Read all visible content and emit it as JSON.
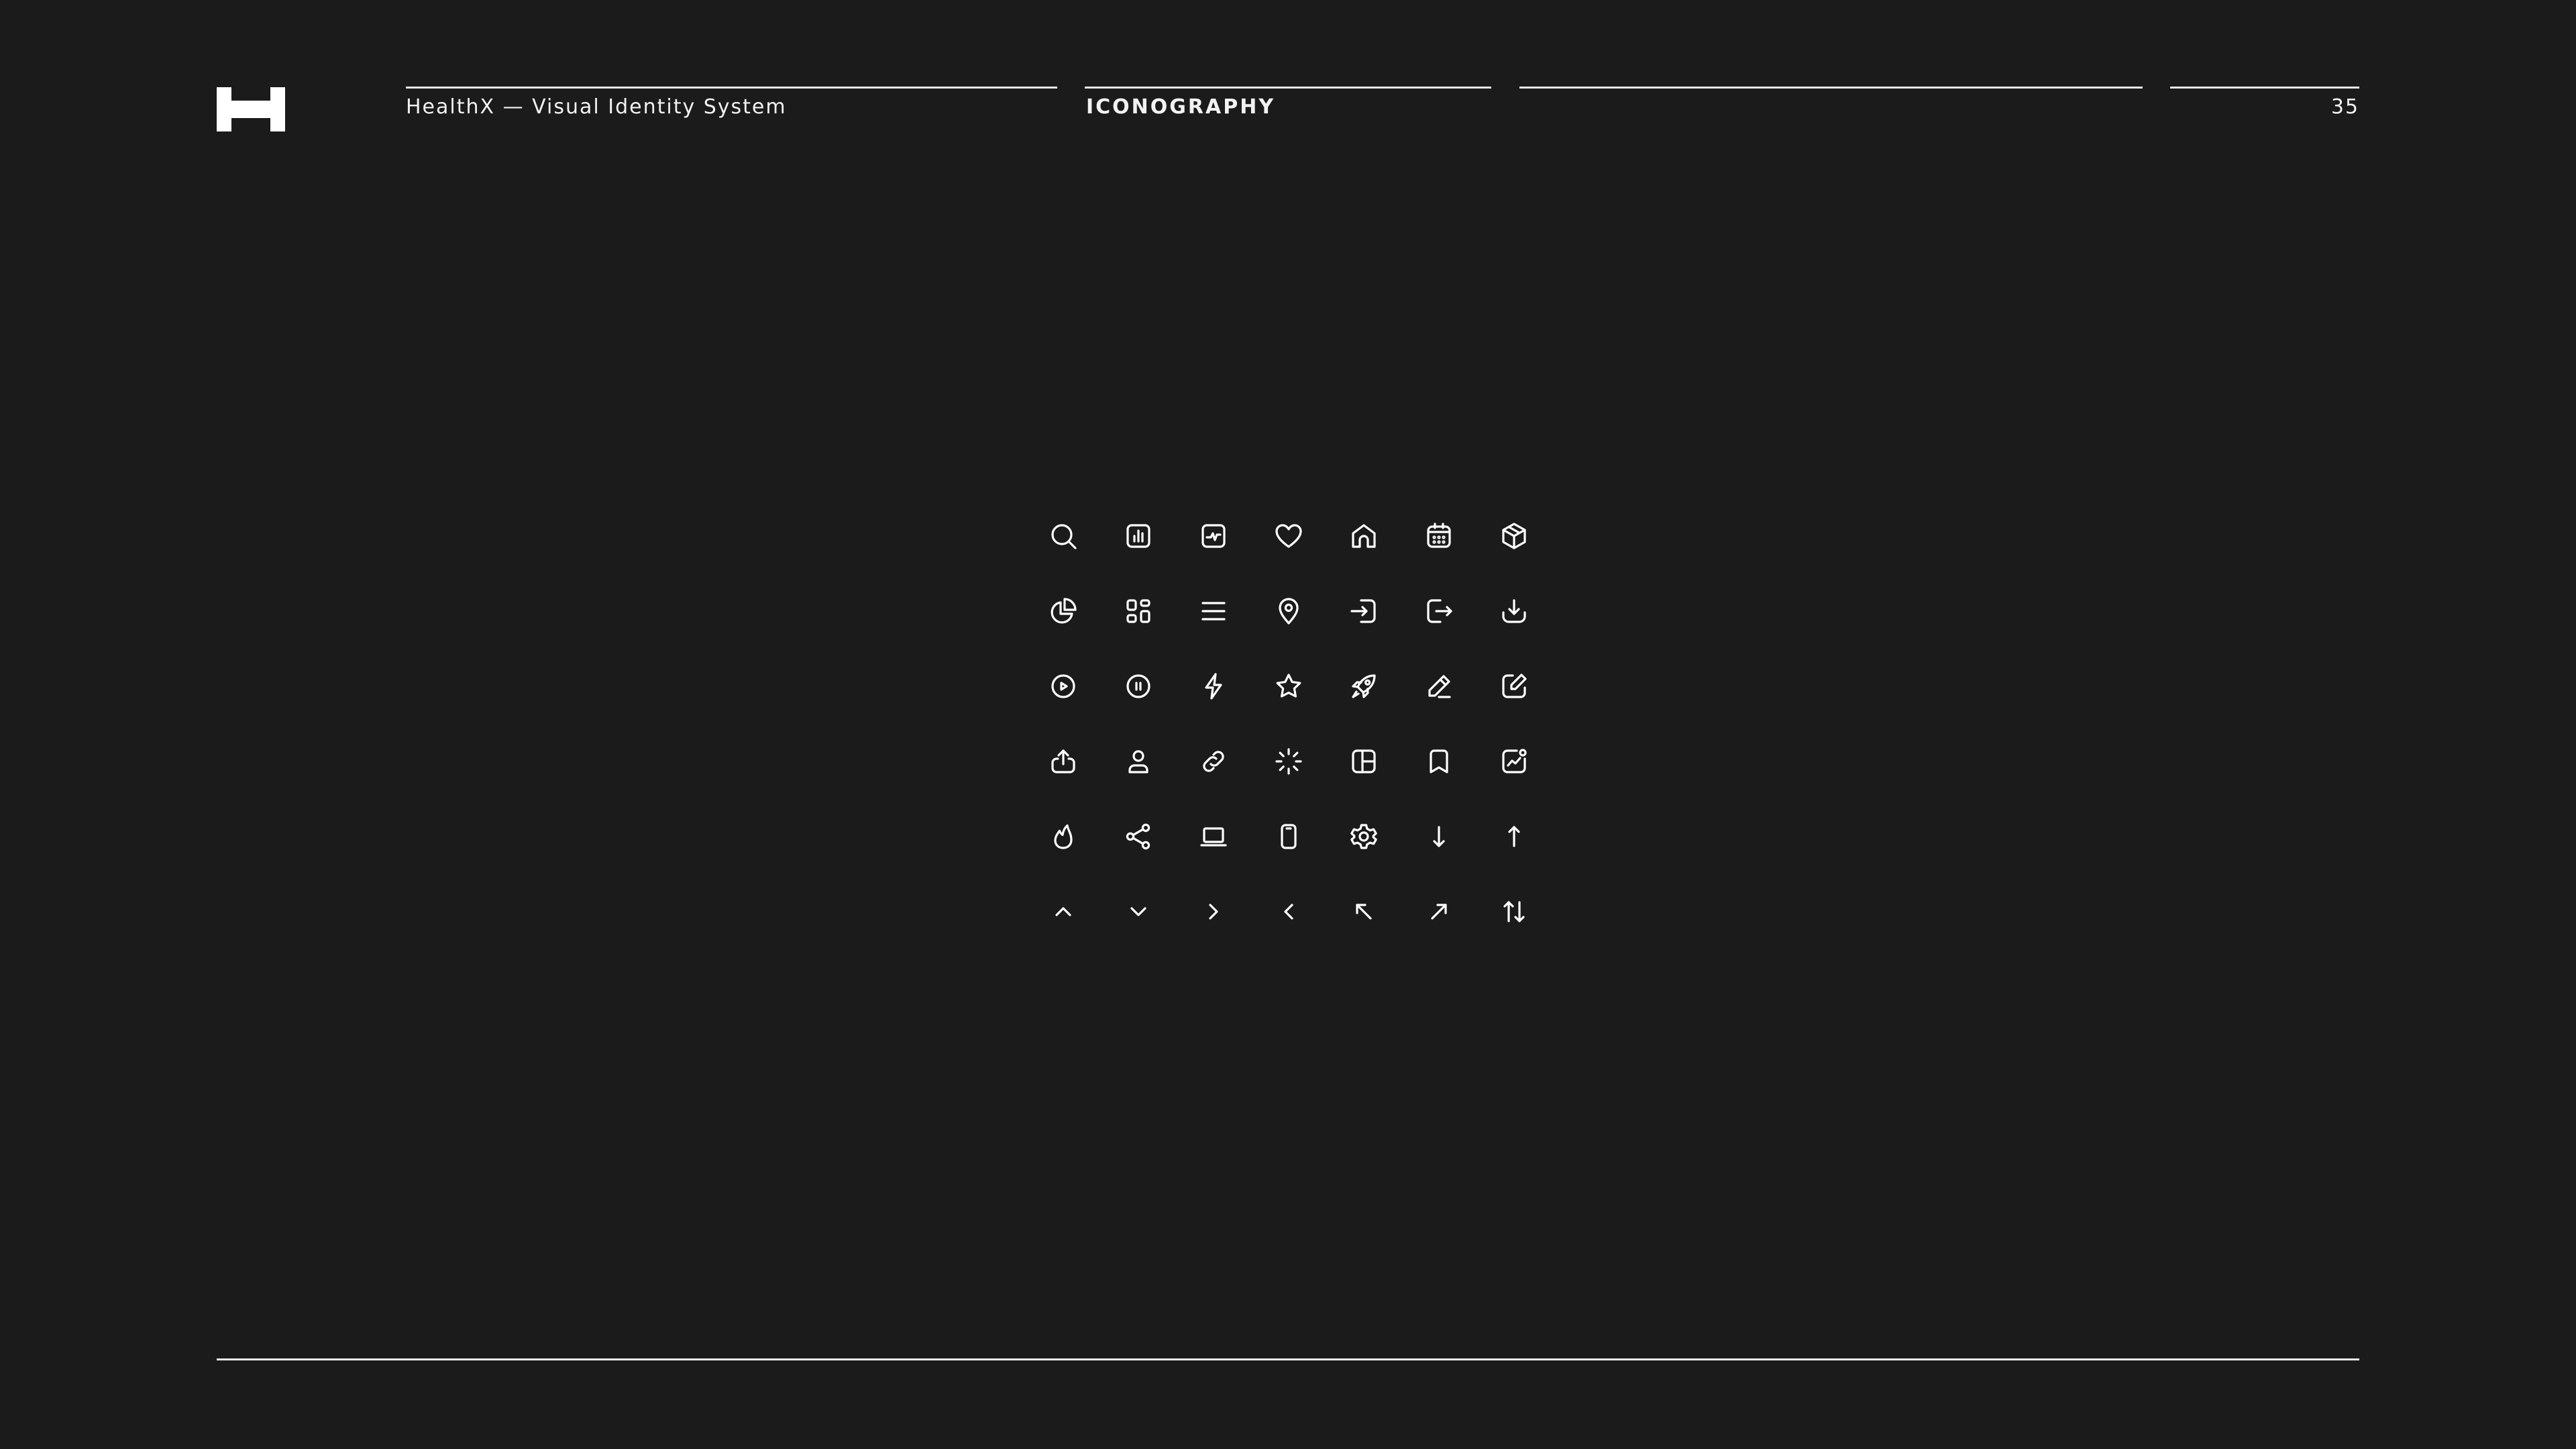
{
  "header": {
    "brand_title": "HealthX — Visual Identity System",
    "section_title": "ICONOGRAPHY",
    "page_number": "35"
  },
  "colors": {
    "background": "#1b1b1b",
    "foreground": "#ffffff"
  },
  "logo": {
    "icon": "h-logo-icon"
  },
  "icons": [
    "search-icon",
    "bar-chart-icon",
    "activity-icon",
    "heart-icon",
    "home-icon",
    "calendar-icon",
    "box-icon",
    "pie-chart-icon",
    "dashboard-icon",
    "menu-icon",
    "map-pin-icon",
    "log-in-icon",
    "log-out-icon",
    "download-icon",
    "play-circle-icon",
    "pause-circle-icon",
    "lightning-icon",
    "star-icon",
    "rocket-icon",
    "pencil-icon",
    "edit-icon",
    "share-upload-icon",
    "user-icon",
    "link-icon",
    "loader-icon",
    "layout-icon",
    "bookmark-icon",
    "trend-notification-icon",
    "flame-icon",
    "share-nodes-icon",
    "laptop-icon",
    "smartphone-icon",
    "settings-icon",
    "arrow-down-icon",
    "arrow-up-icon",
    "chevron-up-icon",
    "chevron-down-icon",
    "chevron-right-icon",
    "chevron-left-icon",
    "arrow-up-left-icon",
    "arrow-up-right-icon",
    "sort-arrows-icon"
  ]
}
